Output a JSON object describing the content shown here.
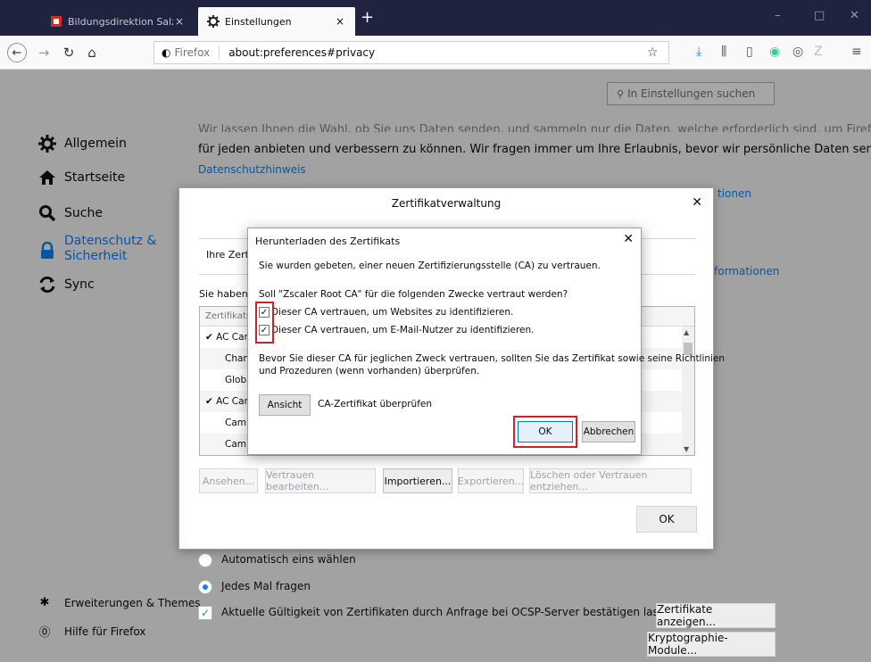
{
  "browser": {
    "tabs": [
      {
        "title": "Bildungsdirektion Salzburg: Sta",
        "icon": "red-logo-icon",
        "active": false
      },
      {
        "title": "Einstellungen",
        "icon": "gear-icon",
        "active": true
      }
    ],
    "url_brand": "Firefox",
    "url": "about:preferences#privacy",
    "new_tab": "+",
    "close": "×",
    "win_min": "–",
    "win_max": "□",
    "win_close": "✕"
  },
  "sidebar": {
    "items": [
      {
        "label": "Allgemein",
        "icon": "gear-icon"
      },
      {
        "label": "Startseite",
        "icon": "home-icon"
      },
      {
        "label": "Suche",
        "icon": "search-icon"
      },
      {
        "label": "Datenschutz &",
        "label2": "Sicherheit",
        "icon": "lock-icon",
        "selected": true
      },
      {
        "label": "Sync",
        "icon": "sync-icon"
      }
    ],
    "footer": [
      {
        "label": "Erweiterungen & Themes",
        "icon": "puzzle-icon"
      },
      {
        "label": "Hilfe für Firefox",
        "icon": "help-icon"
      }
    ]
  },
  "main": {
    "search_placeholder": "In Einstellungen suchen",
    "line1": "Wir lassen Ihnen die Wahl, ob Sie uns Daten senden, und sammeln nur die Daten, welche erforderlich sind, um Firefox",
    "line2": "für jeden anbieten und verbessern zu können. Wir fragen immer um Ihre Erlaubnis, bevor wir persönliche Daten senden.",
    "privacy_link": "Datenschutzhinweis",
    "right_link1": "tionen",
    "right_link2": "formationen",
    "radio1": "Automatisch eins wählen",
    "radio2": "Jedes Mal fragen",
    "ocsp": "Aktuelle Gültigkeit von Zertifikaten durch Anfrage bei OCSP-Server bestätigen lassen",
    "btn_certs": "Zertifikate anzeigen...",
    "btn_crypto": "Kryptographie-Module..."
  },
  "cert_manager": {
    "title": "Zertifikatverwaltung",
    "tab_label": "Ihre Zert",
    "have_text": "Sie haben Z",
    "col_header": "Zertifikats",
    "rows": [
      {
        "label": "✔ AC Cam",
        "indent": 0
      },
      {
        "label": "Chan",
        "indent": 1
      },
      {
        "label": "Glob",
        "indent": 1
      },
      {
        "label": "✔ AC Cam",
        "indent": 0
      },
      {
        "label": "Cam",
        "indent": 1
      },
      {
        "label": "Cam",
        "indent": 1
      }
    ],
    "buttons": [
      "Ansehen...",
      "Vertrauen bearbeiten...",
      "Importieren...",
      "Exportieren...",
      "Löschen oder Vertrauen entziehen..."
    ],
    "ok": "OK"
  },
  "download_dialog": {
    "title": "Herunterladen des Zertifikats",
    "intro": "Sie wurden gebeten, einer neuen Zertifizierungsstelle (CA) zu vertrauen.",
    "question": "Soll \"Zscaler Root CA\" für die folgenden Zwecke vertraut werden?",
    "check1": "Dieser CA vertrauen, um Websites zu identifizieren.",
    "check2": "Dieser CA vertrauen, um E-Mail-Nutzer zu identifizieren.",
    "note1": "Bevor Sie dieser CA für jeglichen Zweck vertrauen, sollten Sie das Zertifikat sowie seine Richtlinien",
    "note2": "und Prozeduren (wenn vorhanden) überprüfen.",
    "view_btn": "Ansicht",
    "view_label": "CA-Zertifikat überprüfen",
    "ok": "OK",
    "cancel": "Abbrechen",
    "check_mark": "✓",
    "close": "✕"
  },
  "colors": {
    "accent": "#0a84ff",
    "highlight_box": "#d0202a",
    "tabstrip": "#202340"
  }
}
